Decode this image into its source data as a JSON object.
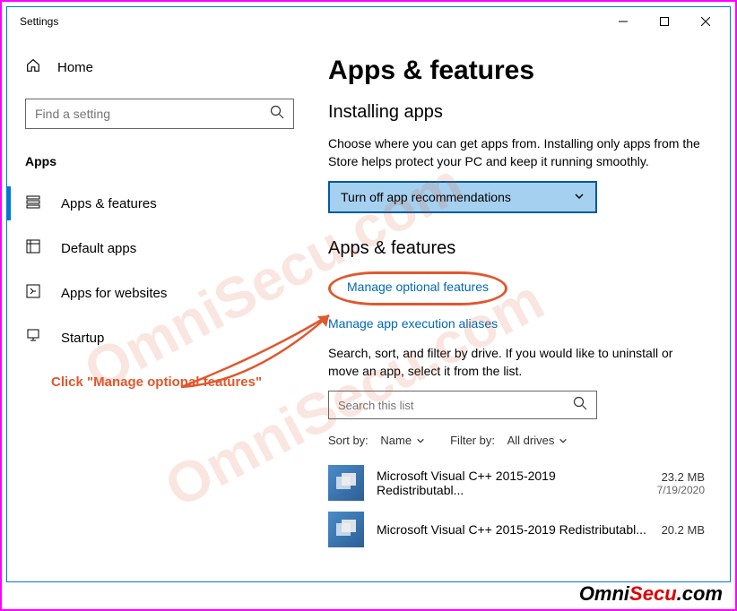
{
  "window": {
    "title": "Settings"
  },
  "sidebar": {
    "home": "Home",
    "searchPlaceholder": "Find a setting",
    "section": "Apps",
    "items": [
      {
        "label": "Apps & features"
      },
      {
        "label": "Default apps"
      },
      {
        "label": "Apps for websites"
      },
      {
        "label": "Startup"
      }
    ]
  },
  "main": {
    "title": "Apps & features",
    "installing": {
      "heading": "Installing apps",
      "body": "Choose where you can get apps from. Installing only apps from the Store helps protect your PC and keep it running smoothly.",
      "dropdown": "Turn off app recommendations"
    },
    "section2": {
      "heading": "Apps & features",
      "link1": "Manage optional features",
      "link2": "Manage app execution aliases",
      "body": "Search, sort, and filter by drive. If you would like to uninstall or move an app, select it from the list.",
      "searchPlaceholder": "Search this list",
      "sortLabel": "Sort by:",
      "sortValue": "Name",
      "filterLabel": "Filter by:",
      "filterValue": "All drives"
    },
    "apps": [
      {
        "name": "Microsoft Visual C++ 2015-2019 Redistributabl...",
        "size": "23.2 MB",
        "date": "7/19/2020"
      },
      {
        "name": "Microsoft Visual C++ 2015-2019 Redistributabl...",
        "size": "20.2 MB",
        "date": ""
      }
    ]
  },
  "annotation": "Click \"Manage optional features\"",
  "watermark": "OmniSecu.com",
  "brand": {
    "p1": "Omni",
    "p2": "Secu",
    "p3": ".com"
  }
}
